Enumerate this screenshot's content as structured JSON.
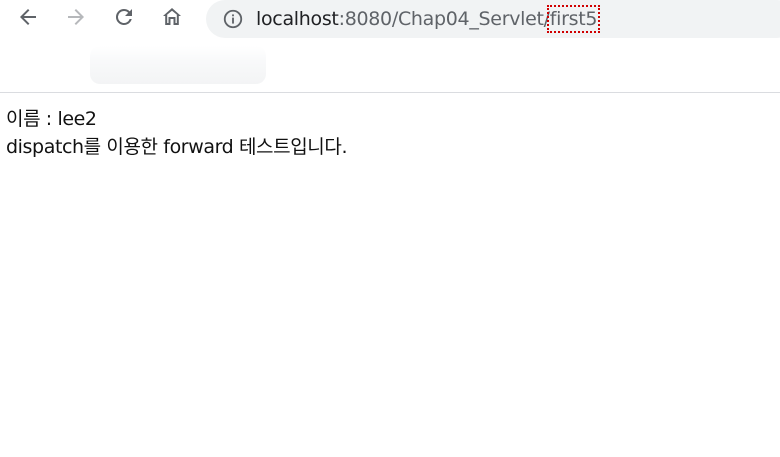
{
  "browser": {
    "buttons": {
      "back": "back-arrow-icon",
      "forward": "forward-arrow-icon",
      "reload": "reload-icon",
      "home": "home-icon"
    },
    "address": {
      "info_icon": "info-icon",
      "host": "localhost",
      "path": ":8080/Chap04_Servlet/",
      "highlighted_path": "first5"
    },
    "colors": {
      "toolbar_bg": "#ffffff",
      "address_bg": "#f1f3f4",
      "highlight_outline": "#d00000"
    }
  },
  "page": {
    "name_line": "이름 : lee2",
    "message_line": "dispatch를 이용한 forward 테스트입니다."
  }
}
